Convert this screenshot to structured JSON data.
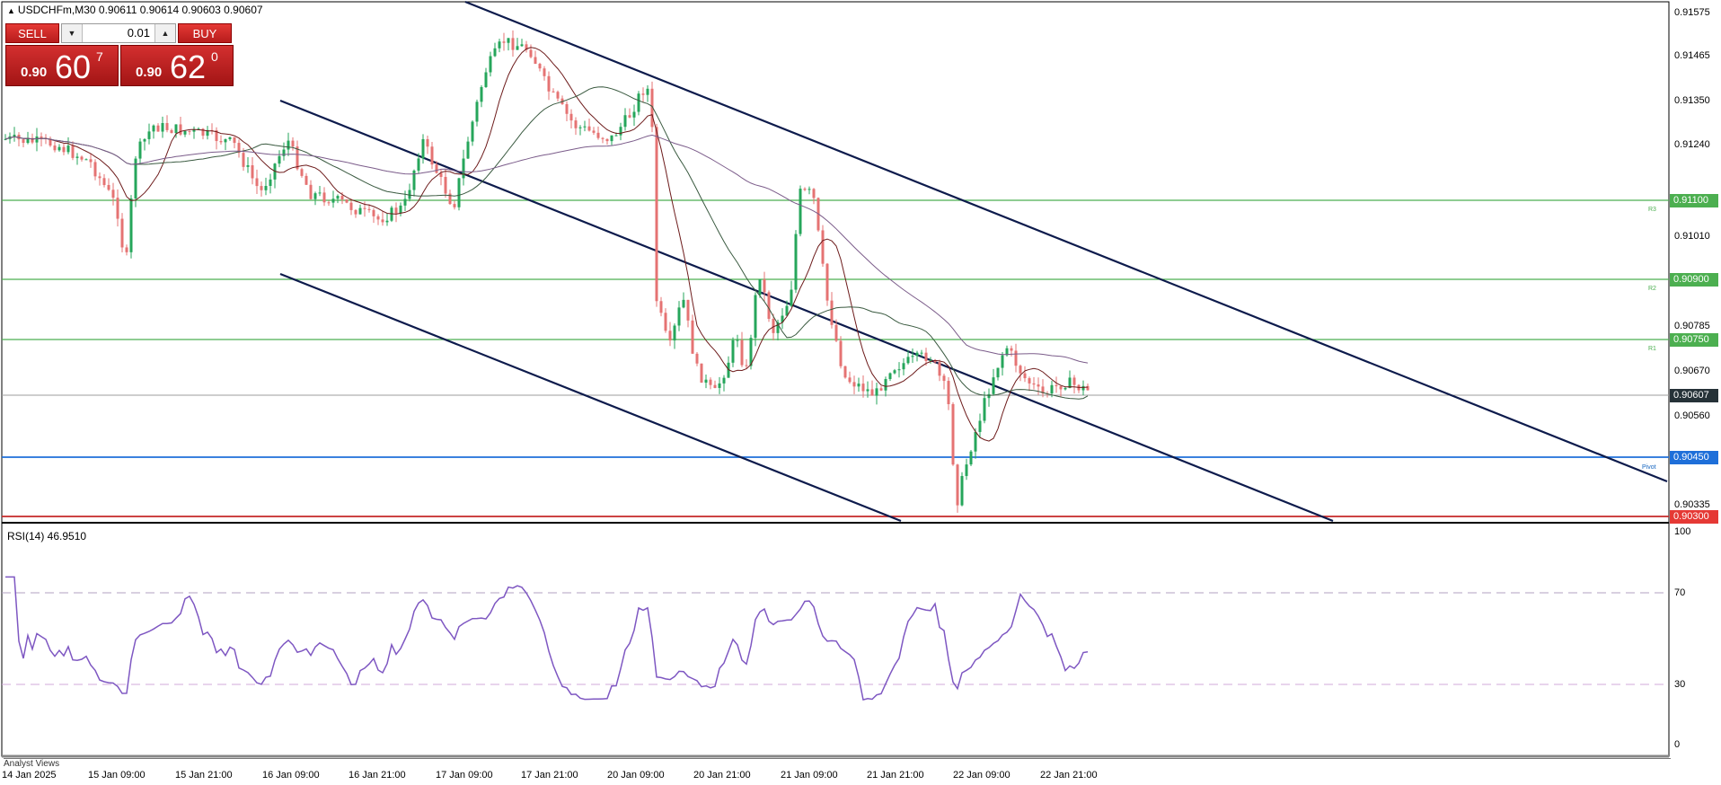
{
  "header": {
    "symbol_line": "USDCHFm,M30  0.90611 0.90614 0.90603 0.90607"
  },
  "trade_panel": {
    "sell_label": "SELL",
    "buy_label": "BUY",
    "lot_value": "0.01",
    "sell_price_small": "0.90",
    "sell_price_big": "60",
    "sell_price_sup": "7",
    "buy_price_small": "0.90",
    "buy_price_big": "62",
    "buy_price_sup": "0"
  },
  "price_axis": {
    "ticks": [
      "0.91575",
      "0.91465",
      "0.91350",
      "0.91240",
      "0.91010",
      "0.90785",
      "0.90670",
      "0.90560",
      "0.90335"
    ],
    "levels": [
      {
        "label": "0.91100",
        "tag": "R3",
        "color": "#4caf50"
      },
      {
        "label": "0.90900",
        "tag": "R2",
        "color": "#4caf50"
      },
      {
        "label": "0.90750",
        "tag": "R1",
        "color": "#4caf50"
      },
      {
        "label": "0.90607",
        "tag": "",
        "color": "#263238"
      },
      {
        "label": "0.90450",
        "tag": "Pivot",
        "color": "#1e6fd9"
      },
      {
        "label": "0.90300",
        "tag": "",
        "color": "#e53935"
      }
    ]
  },
  "rsi": {
    "title": "RSI(14) 46.9510",
    "ticks": [
      "100",
      "70",
      "30",
      "0"
    ],
    "line_color": "#7e57c2"
  },
  "time_axis": {
    "labels": [
      "14 Jan 2025",
      "15 Jan 09:00",
      "15 Jan 21:00",
      "16 Jan 09:00",
      "16 Jan 21:00",
      "17 Jan 09:00",
      "17 Jan 21:00",
      "20 Jan 09:00",
      "20 Jan 21:00",
      "21 Jan 09:00",
      "21 Jan 21:00",
      "22 Jan 09:00",
      "22 Jan 21:00"
    ]
  },
  "footer": {
    "tab_label": "Analyst Views"
  },
  "colors": {
    "bull": "#26a65b",
    "bear": "#e57373",
    "channel": "#0d1b4c",
    "ma_fast": "#6d1b1b",
    "ma_mid": "#3a5a40",
    "ma_slow": "#7b5c8a"
  }
}
